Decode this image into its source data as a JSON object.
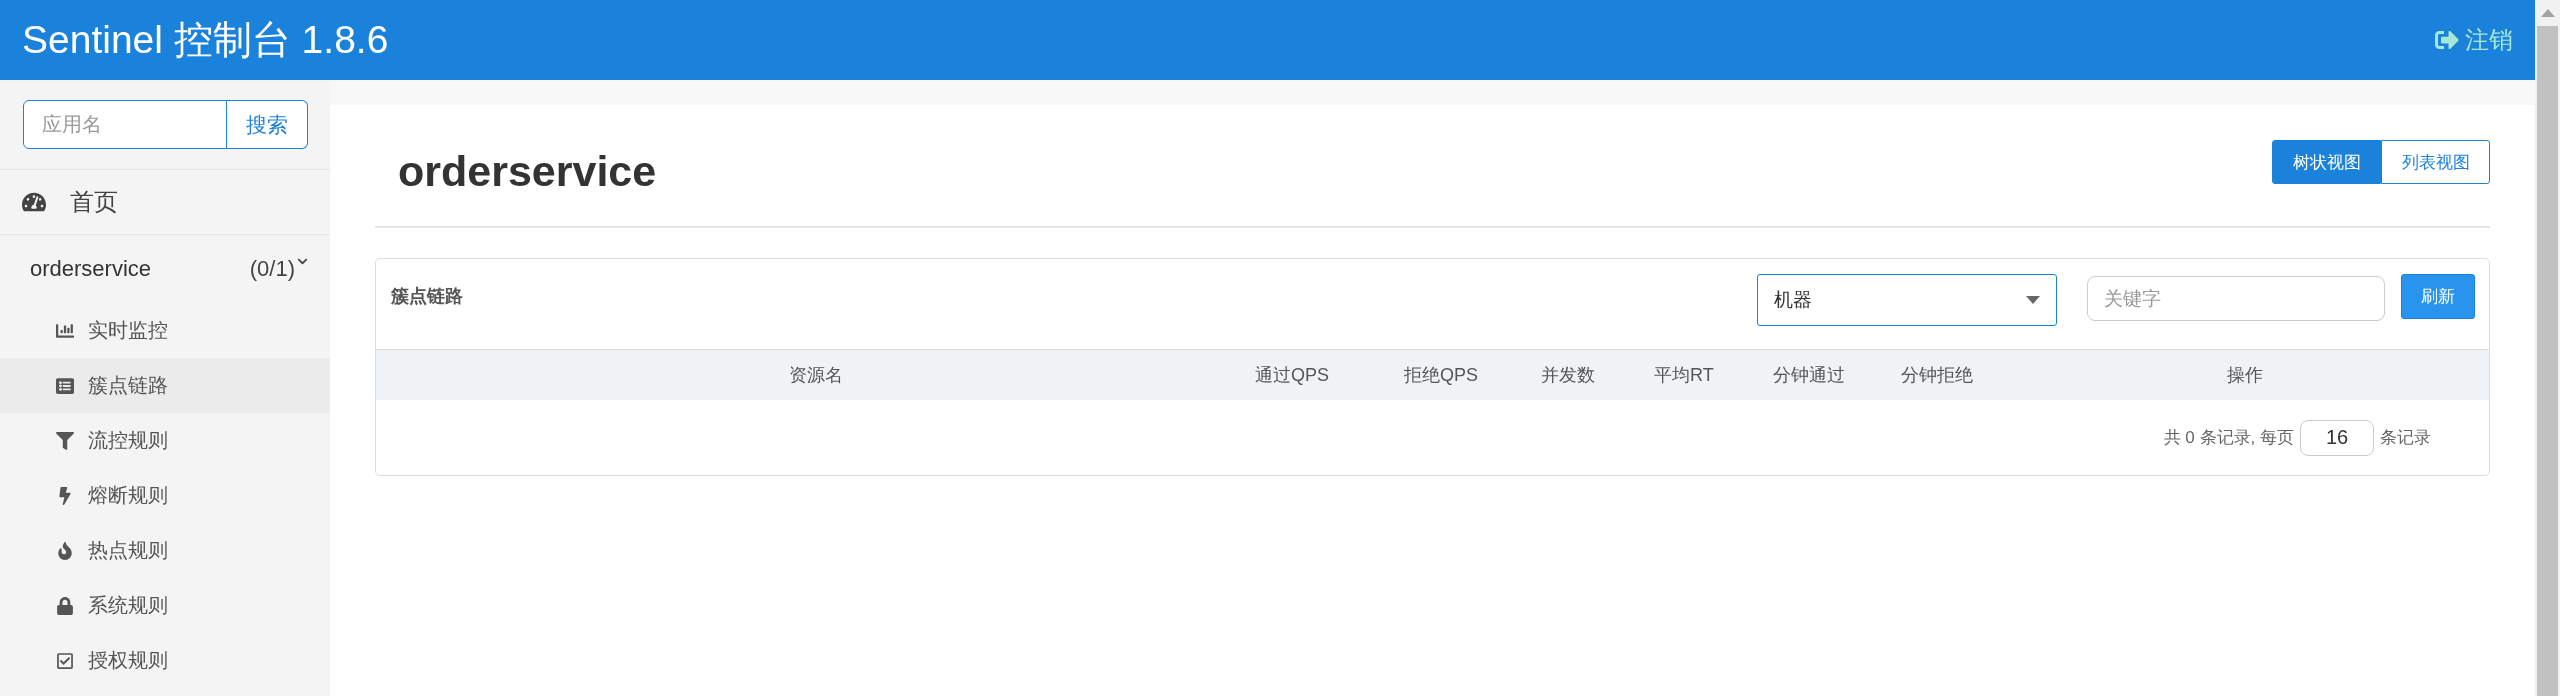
{
  "header": {
    "title": "Sentinel 控制台 1.8.6",
    "logout": "注销"
  },
  "sidebar": {
    "search": {
      "placeholder": "应用名",
      "button": "搜索"
    },
    "home": "首页",
    "app": {
      "name": "orderservice",
      "count": "(0/1)",
      "expanded": true
    },
    "items": [
      {
        "label": "实时监控",
        "selected": false
      },
      {
        "label": "簇点链路",
        "selected": true
      },
      {
        "label": "流控规则",
        "selected": false
      },
      {
        "label": "熔断规则",
        "selected": false
      },
      {
        "label": "热点规则",
        "selected": false
      },
      {
        "label": "系统规则",
        "selected": false
      },
      {
        "label": "授权规则",
        "selected": false
      }
    ]
  },
  "content": {
    "title": "orderservice",
    "views": [
      {
        "label": "树状视图",
        "selected": true
      },
      {
        "label": "列表视图",
        "selected": false
      }
    ],
    "card": {
      "title": "簇点链路",
      "machine_select": {
        "value": "机器"
      },
      "keyword": {
        "placeholder": "关键字"
      },
      "refresh": "刷新",
      "columns": [
        "资源名",
        "通过QPS",
        "拒绝QPS",
        "并发数",
        "平均RT",
        "分钟通过",
        "分钟拒绝",
        "操作"
      ],
      "pagination": {
        "before": "共 0 条记录, 每页",
        "page_size": "16",
        "after": "条记录"
      }
    }
  }
}
